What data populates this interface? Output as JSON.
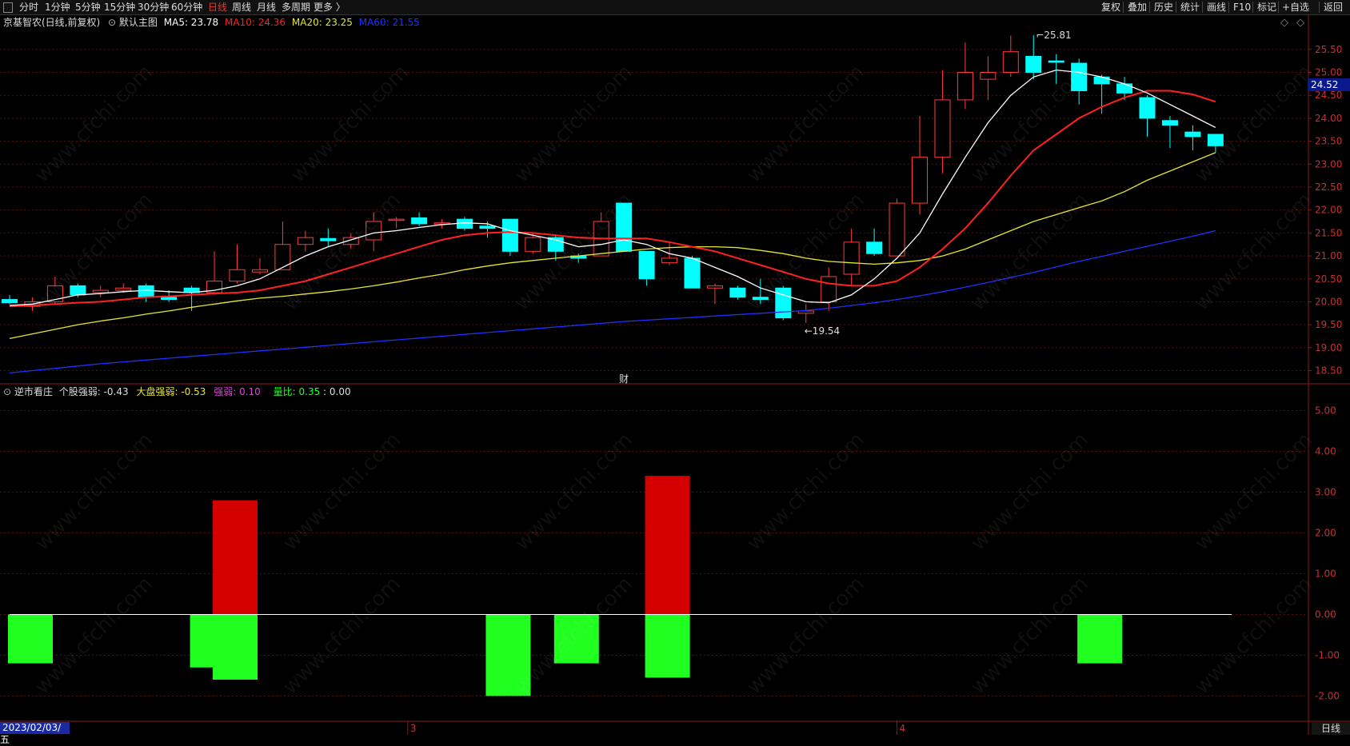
{
  "toolbar": {
    "periods": [
      "分时",
      "1分钟",
      "5分钟",
      "15分钟",
      "30分钟",
      "60分钟",
      "日线",
      "周线",
      "月线",
      "多周期",
      "更多 〉"
    ],
    "active_period": "日线",
    "right_buttons": [
      "复权",
      "叠加",
      "历史",
      "统计",
      "画线",
      "F10",
      "标记",
      "+自选",
      "返回"
    ]
  },
  "main_legend": {
    "stock": "京基智农(日线,前复权)",
    "indicator": "默认主图",
    "ma5": "MA5: 23.78",
    "ma10": "MA10: 24.36",
    "ma20": "MA20: 23.25",
    "ma60": "MA60: 21.55"
  },
  "sub_legend": {
    "name": "逆市看庄",
    "p1": "个股强弱: -0.43",
    "p2": "大盘强弱: -0.53",
    "p3": "强弱: 0.10",
    "p4": "量比: 0.35",
    "p5": ": 0.00"
  },
  "labels": {
    "high_mark": "25.81",
    "low_mark": "←19.54",
    "fin_mark": "财",
    "current_price": "24.52",
    "date": "2023/02/03/五",
    "month_3": "3",
    "month_4": "4",
    "period_label": "日线"
  },
  "watermark": "www.cfchi.com",
  "colors": {
    "up": "#ff3b3b",
    "down": "#00ffff",
    "ma5": "#ffffff",
    "ma10": "#ff2020",
    "ma20": "#e6e62e",
    "ma60": "#2030ff",
    "bar_red": "#d40000",
    "bar_green": "#20ff20"
  },
  "price_axis": [
    "25.50",
    "25.00",
    "24.50",
    "24.00",
    "23.50",
    "23.00",
    "22.50",
    "22.00",
    "21.50",
    "21.00",
    "20.50",
    "20.00",
    "19.50",
    "19.00",
    "18.50"
  ],
  "sub_axis": [
    "5.00",
    "4.00",
    "3.00",
    "2.00",
    "1.00",
    "0.00",
    "-1.00",
    "-2.00"
  ],
  "chart_data": {
    "type": "candlestick",
    "ylim": [
      18.3,
      25.95
    ],
    "candles": [
      {
        "o": 20.05,
        "c": 19.98,
        "h": 20.15,
        "l": 19.95
      },
      {
        "o": 19.9,
        "c": 20.0,
        "h": 20.1,
        "l": 19.8
      },
      {
        "o": 20.0,
        "c": 20.35,
        "h": 20.55,
        "l": 19.95
      },
      {
        "o": 20.35,
        "c": 20.15,
        "h": 20.4,
        "l": 20.1
      },
      {
        "o": 20.2,
        "c": 20.25,
        "h": 20.35,
        "l": 20.1
      },
      {
        "o": 20.25,
        "c": 20.3,
        "h": 20.4,
        "l": 20.2
      },
      {
        "o": 20.35,
        "c": 20.1,
        "h": 20.4,
        "l": 20.0
      },
      {
        "o": 20.1,
        "c": 20.05,
        "h": 20.25,
        "l": 20.0
      },
      {
        "o": 20.3,
        "c": 20.2,
        "h": 20.35,
        "l": 19.8
      },
      {
        "o": 20.2,
        "c": 20.45,
        "h": 21.1,
        "l": 20.15
      },
      {
        "o": 20.45,
        "c": 20.7,
        "h": 21.25,
        "l": 20.4
      },
      {
        "o": 20.65,
        "c": 20.7,
        "h": 20.95,
        "l": 20.6
      },
      {
        "o": 20.7,
        "c": 21.25,
        "h": 21.75,
        "l": 20.7
      },
      {
        "o": 21.25,
        "c": 21.4,
        "h": 21.55,
        "l": 21.1
      },
      {
        "o": 21.38,
        "c": 21.33,
        "h": 21.6,
        "l": 21.2
      },
      {
        "o": 21.25,
        "c": 21.4,
        "h": 21.5,
        "l": 21.15
      },
      {
        "o": 21.35,
        "c": 21.75,
        "h": 21.95,
        "l": 21.1
      },
      {
        "o": 21.78,
        "c": 21.8,
        "h": 21.85,
        "l": 21.6
      },
      {
        "o": 21.83,
        "c": 21.7,
        "h": 21.95,
        "l": 21.65
      },
      {
        "o": 21.7,
        "c": 21.72,
        "h": 21.8,
        "l": 21.6
      },
      {
        "o": 21.8,
        "c": 21.6,
        "h": 21.85,
        "l": 21.55
      },
      {
        "o": 21.65,
        "c": 21.6,
        "h": 21.75,
        "l": 21.4
      },
      {
        "o": 21.8,
        "c": 21.1,
        "h": 21.8,
        "l": 21.0
      },
      {
        "o": 21.1,
        "c": 21.4,
        "h": 21.5,
        "l": 21.05
      },
      {
        "o": 21.4,
        "c": 21.1,
        "h": 21.45,
        "l": 20.9
      },
      {
        "o": 21.0,
        "c": 20.95,
        "h": 21.05,
        "l": 20.85
      },
      {
        "o": 21.0,
        "c": 21.75,
        "h": 21.95,
        "l": 21.0
      },
      {
        "o": 22.15,
        "c": 21.1,
        "h": 22.15,
        "l": 21.1
      },
      {
        "o": 21.1,
        "c": 20.5,
        "h": 21.1,
        "l": 20.35
      },
      {
        "o": 20.85,
        "c": 20.95,
        "h": 21.3,
        "l": 20.8
      },
      {
        "o": 20.95,
        "c": 20.3,
        "h": 21.0,
        "l": 20.3
      },
      {
        "o": 20.3,
        "c": 20.35,
        "h": 20.4,
        "l": 19.95
      },
      {
        "o": 20.3,
        "c": 20.1,
        "h": 20.35,
        "l": 20.05
      },
      {
        "o": 20.1,
        "c": 20.05,
        "h": 20.5,
        "l": 19.95
      },
      {
        "o": 20.3,
        "c": 19.65,
        "h": 20.35,
        "l": 19.6
      },
      {
        "o": 19.75,
        "c": 19.8,
        "h": 19.95,
        "l": 19.54
      },
      {
        "o": 20.0,
        "c": 20.55,
        "h": 20.75,
        "l": 19.8
      },
      {
        "o": 20.6,
        "c": 21.3,
        "h": 21.6,
        "l": 20.35
      },
      {
        "o": 21.3,
        "c": 21.05,
        "h": 21.6,
        "l": 21.0
      },
      {
        "o": 21.0,
        "c": 22.15,
        "h": 22.25,
        "l": 21.0
      },
      {
        "o": 22.15,
        "c": 23.15,
        "h": 24.05,
        "l": 21.9
      },
      {
        "o": 23.15,
        "c": 24.4,
        "h": 25.05,
        "l": 22.8
      },
      {
        "o": 24.4,
        "c": 25.0,
        "h": 25.65,
        "l": 24.2
      },
      {
        "o": 24.85,
        "c": 25.0,
        "h": 25.35,
        "l": 24.4
      },
      {
        "o": 25.0,
        "c": 25.45,
        "h": 25.8,
        "l": 24.9
      },
      {
        "o": 25.35,
        "c": 25.0,
        "h": 25.81,
        "l": 24.85
      },
      {
        "o": 25.25,
        "c": 25.22,
        "h": 25.4,
        "l": 24.75
      },
      {
        "o": 25.2,
        "c": 24.6,
        "h": 25.3,
        "l": 24.3
      },
      {
        "o": 24.9,
        "c": 24.75,
        "h": 24.95,
        "l": 24.1
      },
      {
        "o": 24.75,
        "c": 24.55,
        "h": 24.9,
        "l": 24.4
      },
      {
        "o": 24.45,
        "c": 24.0,
        "h": 24.5,
        "l": 23.6
      },
      {
        "o": 23.95,
        "c": 23.85,
        "h": 24.05,
        "l": 23.35
      },
      {
        "o": 23.7,
        "c": 23.6,
        "h": 23.85,
        "l": 23.3
      },
      {
        "o": 23.65,
        "c": 23.4,
        "h": 23.65,
        "l": 23.25
      }
    ],
    "ma": {
      "ma5": [
        19.92,
        19.95,
        20.05,
        20.15,
        20.18,
        20.22,
        20.25,
        20.22,
        20.2,
        20.25,
        20.35,
        20.5,
        20.75,
        21.0,
        21.2,
        21.35,
        21.5,
        21.55,
        21.62,
        21.68,
        21.72,
        21.7,
        21.55,
        21.45,
        21.35,
        21.2,
        21.25,
        21.35,
        21.25,
        21.05,
        20.95,
        20.75,
        20.55,
        20.3,
        20.15,
        20.0,
        19.98,
        20.15,
        20.5,
        20.95,
        21.5,
        22.35,
        23.15,
        23.9,
        24.5,
        24.9,
        25.05,
        25.0,
        24.9,
        24.75,
        24.55,
        24.3,
        24.05,
        23.8
      ],
      "ma10": [
        19.9,
        19.92,
        19.95,
        19.98,
        20.0,
        20.05,
        20.1,
        20.12,
        20.15,
        20.18,
        20.2,
        20.25,
        20.35,
        20.45,
        20.6,
        20.75,
        20.9,
        21.05,
        21.2,
        21.35,
        21.45,
        21.5,
        21.52,
        21.5,
        21.45,
        21.4,
        21.38,
        21.38,
        21.38,
        21.3,
        21.2,
        21.1,
        20.95,
        20.8,
        20.65,
        20.5,
        20.4,
        20.35,
        20.35,
        20.45,
        20.75,
        21.15,
        21.6,
        22.15,
        22.75,
        23.3,
        23.65,
        24.0,
        24.25,
        24.45,
        24.6,
        24.6,
        24.52,
        24.36
      ],
      "ma20": [
        19.2,
        19.3,
        19.4,
        19.5,
        19.58,
        19.65,
        19.73,
        19.8,
        19.88,
        19.95,
        20.02,
        20.08,
        20.12,
        20.17,
        20.22,
        20.28,
        20.35,
        20.43,
        20.52,
        20.6,
        20.7,
        20.78,
        20.85,
        20.9,
        20.95,
        21.0,
        21.05,
        21.1,
        21.15,
        21.18,
        21.2,
        21.2,
        21.18,
        21.12,
        21.05,
        20.95,
        20.88,
        20.85,
        20.82,
        20.85,
        20.9,
        21.0,
        21.15,
        21.35,
        21.55,
        21.75,
        21.9,
        22.05,
        22.2,
        22.4,
        22.65,
        22.85,
        23.05,
        23.25
      ],
      "ma60": [
        18.45,
        18.5,
        18.55,
        18.6,
        18.65,
        18.69,
        18.73,
        18.77,
        18.81,
        18.85,
        18.89,
        18.93,
        18.97,
        19.01,
        19.05,
        19.09,
        19.13,
        19.17,
        19.21,
        19.25,
        19.29,
        19.33,
        19.37,
        19.41,
        19.45,
        19.49,
        19.53,
        19.57,
        19.6,
        19.63,
        19.66,
        19.69,
        19.72,
        19.75,
        19.78,
        19.81,
        19.86,
        19.92,
        19.98,
        20.05,
        20.13,
        20.22,
        20.32,
        20.42,
        20.53,
        20.64,
        20.76,
        20.88,
        20.99,
        21.1,
        21.21,
        21.32,
        21.43,
        21.55
      ]
    },
    "sub_indicator": {
      "ylim": [
        -2.6,
        5.6
      ],
      "bars": [
        {
          "x": 0,
          "y": -1.2,
          "color": "green"
        },
        {
          "x": 8,
          "y": -1.3,
          "color": "green"
        },
        {
          "x": 9,
          "y": -1.6,
          "color": "green"
        },
        {
          "x": 9,
          "y": 2.8,
          "color": "red"
        },
        {
          "x": 21,
          "y": -2.0,
          "color": "green"
        },
        {
          "x": 24,
          "y": -1.2,
          "color": "green"
        },
        {
          "x": 28,
          "y": -1.55,
          "color": "green"
        },
        {
          "x": 28,
          "y": 3.4,
          "color": "red"
        },
        {
          "x": 47,
          "y": -1.2,
          "color": "green"
        }
      ]
    }
  }
}
